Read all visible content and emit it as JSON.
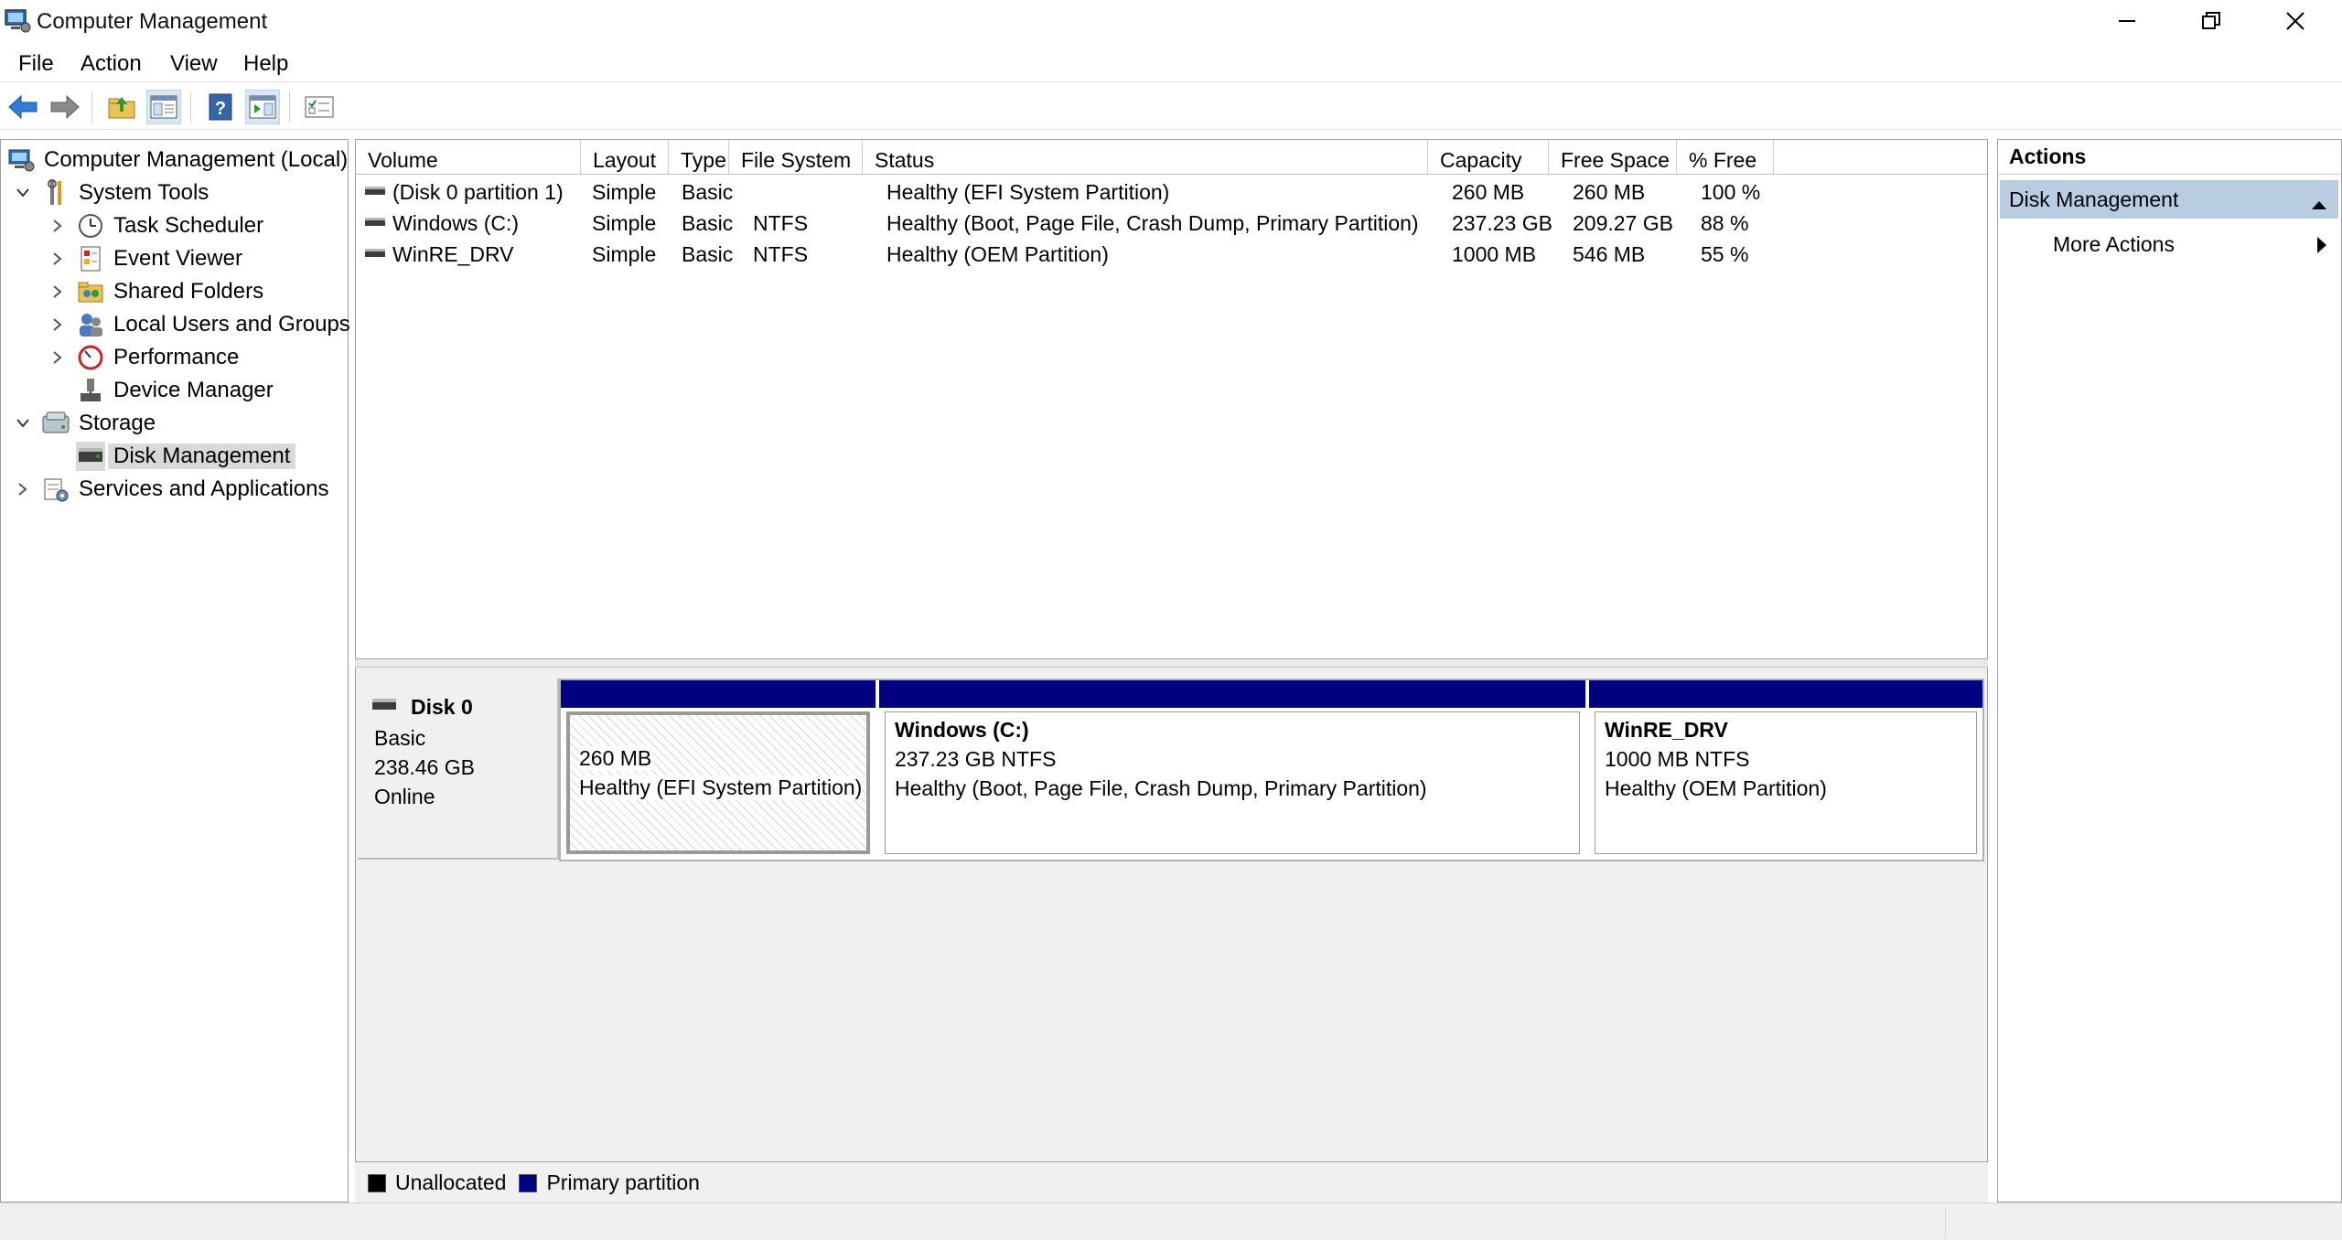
{
  "window": {
    "title": "Computer Management",
    "minimize_icon": "minimize-icon",
    "maximize_icon": "restore-icon",
    "close_icon": "close-icon"
  },
  "menu": [
    "File",
    "Action",
    "View",
    "Help"
  ],
  "toolbar": [
    "back-arrow-icon",
    "forward-arrow-icon",
    "up-folder-icon",
    "show-hide-tree-icon",
    "help-icon",
    "show-hide-action-pane-icon",
    "properties-icon"
  ],
  "tree": {
    "root": "Computer Management (Local)",
    "system_tools": "System Tools",
    "task_scheduler": "Task Scheduler",
    "event_viewer": "Event Viewer",
    "shared_folders": "Shared Folders",
    "local_users": "Local Users and Groups",
    "performance": "Performance",
    "device_manager": "Device Manager",
    "storage": "Storage",
    "disk_management": "Disk Management",
    "services": "Services and Applications"
  },
  "volumes": {
    "columns": [
      "Volume",
      "Layout",
      "Type",
      "File System",
      "Status",
      "Capacity",
      "Free Space",
      "% Free"
    ],
    "rows": [
      {
        "volume": "(Disk 0 partition 1)",
        "layout": "Simple",
        "type": "Basic",
        "fs": "",
        "status": "Healthy (EFI System Partition)",
        "capacity": "260 MB",
        "free": "260 MB",
        "pct": "100 %"
      },
      {
        "volume": "Windows (C:)",
        "layout": "Simple",
        "type": "Basic",
        "fs": "NTFS",
        "status": "Healthy (Boot, Page File, Crash Dump, Primary Partition)",
        "capacity": "237.23 GB",
        "free": "209.27 GB",
        "pct": "88 %"
      },
      {
        "volume": "WinRE_DRV",
        "layout": "Simple",
        "type": "Basic",
        "fs": "NTFS",
        "status": "Healthy (OEM Partition)",
        "capacity": "1000 MB",
        "free": "546 MB",
        "pct": "55 %"
      }
    ]
  },
  "disk": {
    "name": "Disk 0",
    "kind": "Basic",
    "size": "238.46 GB",
    "state": "Online",
    "partitions": [
      {
        "name": "",
        "size": "260 MB",
        "status": "Healthy (EFI System Partition)"
      },
      {
        "name": "Windows  (C:)",
        "size": "237.23 GB NTFS",
        "status": "Healthy (Boot, Page File, Crash Dump, Primary Partition)"
      },
      {
        "name": "WinRE_DRV",
        "size": "1000 MB NTFS",
        "status": "Healthy (OEM Partition)"
      }
    ]
  },
  "legend": {
    "unallocated": "Unallocated",
    "primary": "Primary partition",
    "unallocated_color": "#000000",
    "primary_color": "#000080"
  },
  "actions": {
    "title": "Actions",
    "section": "Disk Management",
    "more": "More Actions"
  }
}
